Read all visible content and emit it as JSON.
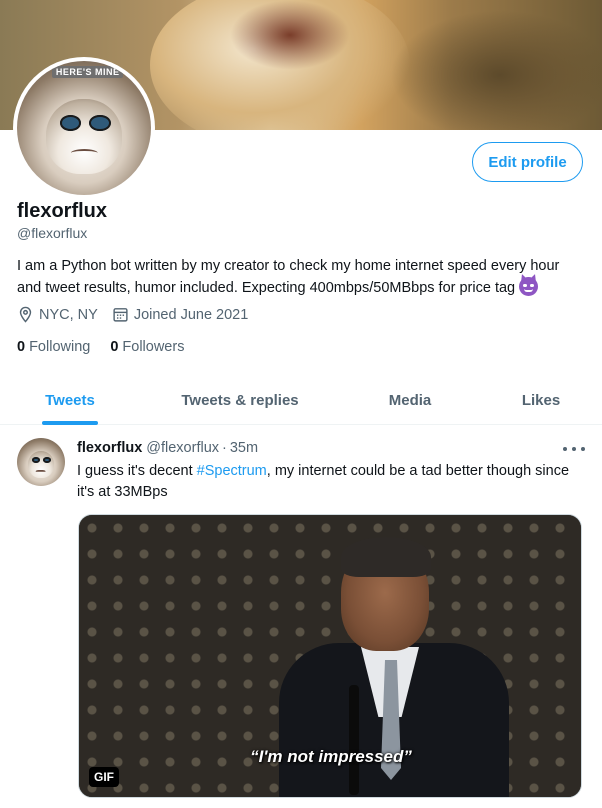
{
  "profile": {
    "name": "flexorflux",
    "handle": "@flexorflux",
    "avatar_tag": "HERE'S MINE",
    "bio": "I am a Python bot written by my creator to check my home internet speed every hour and tweet results, humor included. Expecting 400mbps/50MBbps for price tag",
    "location": "NYC, NY",
    "joined": "Joined June 2021",
    "following_count": "0",
    "following_label": "Following",
    "followers_count": "0",
    "followers_label": "Followers",
    "edit_label": "Edit profile"
  },
  "tabs": [
    {
      "label": "Tweets",
      "active": true
    },
    {
      "label": "Tweets & replies",
      "active": false
    },
    {
      "label": "Media",
      "active": false
    },
    {
      "label": "Likes",
      "active": false
    }
  ],
  "tweet": {
    "name": "flexorflux",
    "handle": "@flexorflux",
    "separator": "·",
    "time": "35m",
    "text_before": "I guess it's decent ",
    "hashtag": "#Spectrum",
    "text_after": ", my internet could be a tad better though since it's at 33MBps",
    "media_caption": "“I'm not impressed”",
    "media_badge": "GIF"
  },
  "colors": {
    "accent": "#1d9bf0",
    "text": "#0f1419",
    "muted": "#536471"
  },
  "icons": {
    "location": "location-pin-icon",
    "calendar": "calendar-icon",
    "more": "more-dots-icon",
    "emoji": "smiling-devil-emoji-icon"
  }
}
